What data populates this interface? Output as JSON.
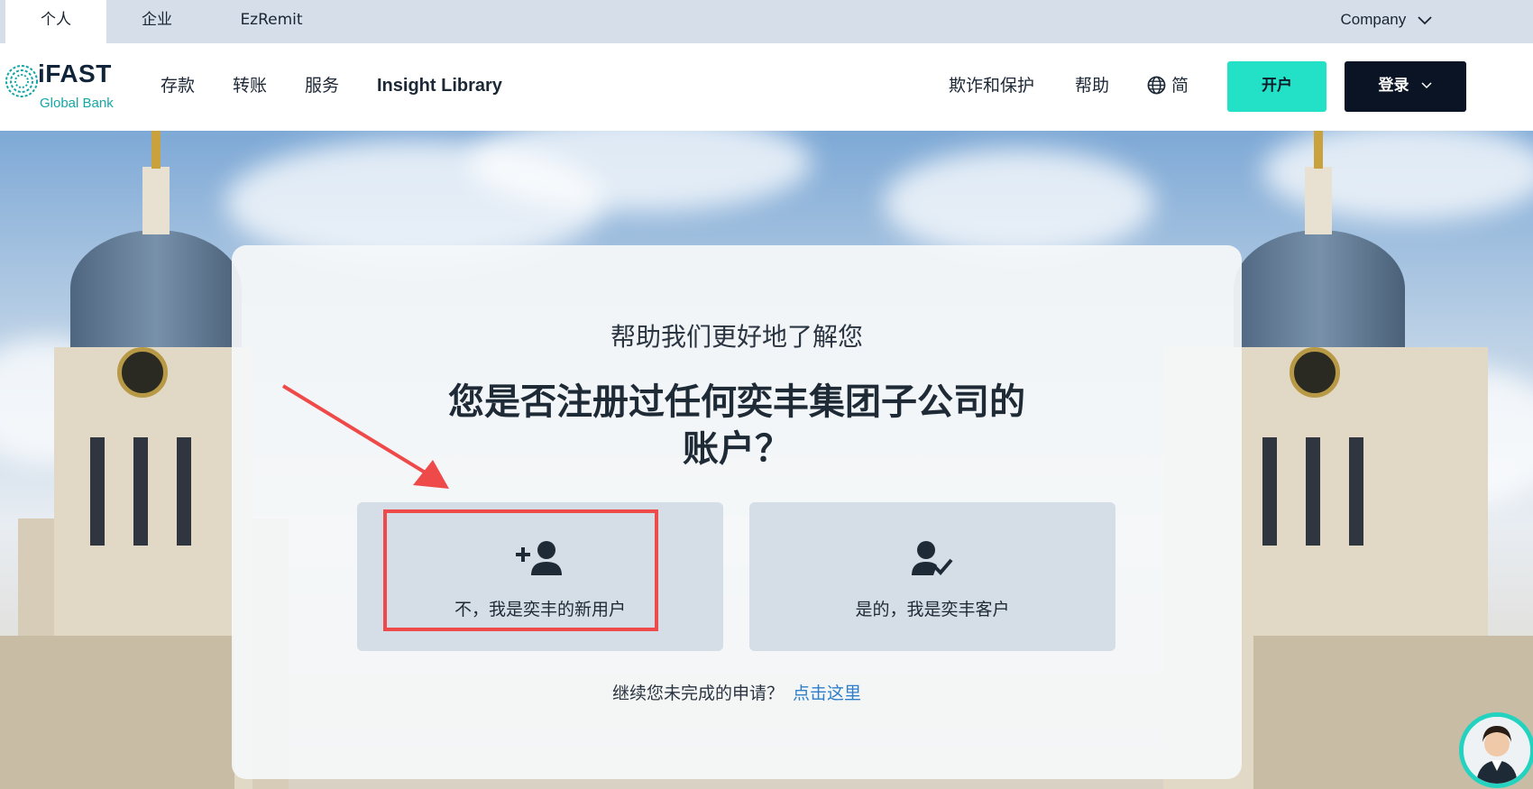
{
  "topbar": {
    "tabs": [
      {
        "label": "个人",
        "active": true
      },
      {
        "label": "企业",
        "active": false
      },
      {
        "label": "EzRemit",
        "active": false
      }
    ],
    "company_label": "Company"
  },
  "logo": {
    "word": "iFAST",
    "sub": "Global Bank"
  },
  "nav": {
    "links": [
      "存款",
      "转账",
      "服务",
      "Insight Library"
    ],
    "right_links": [
      "欺诈和保护",
      "帮助"
    ],
    "language": "简",
    "open_account": "开户",
    "login": "登录"
  },
  "card": {
    "subtitle": "帮助我们更好地了解您",
    "question_line1": "您是否注册过任何奕丰集团子公司的",
    "question_line2": "账户？",
    "options": [
      {
        "label": "不，我是奕丰的新用户",
        "icon": "user-plus-icon"
      },
      {
        "label": "是的，我是奕丰客户",
        "icon": "user-check-icon"
      }
    ],
    "continue_text": "继续您未完成的申请？",
    "continue_link": "点击这里"
  },
  "colors": {
    "accent_teal": "#22e1c6",
    "login_dark": "#0b1424",
    "link_blue": "#2d7ec9",
    "highlight_red": "#ef4a4a",
    "logo_teal": "#15a7a6"
  }
}
